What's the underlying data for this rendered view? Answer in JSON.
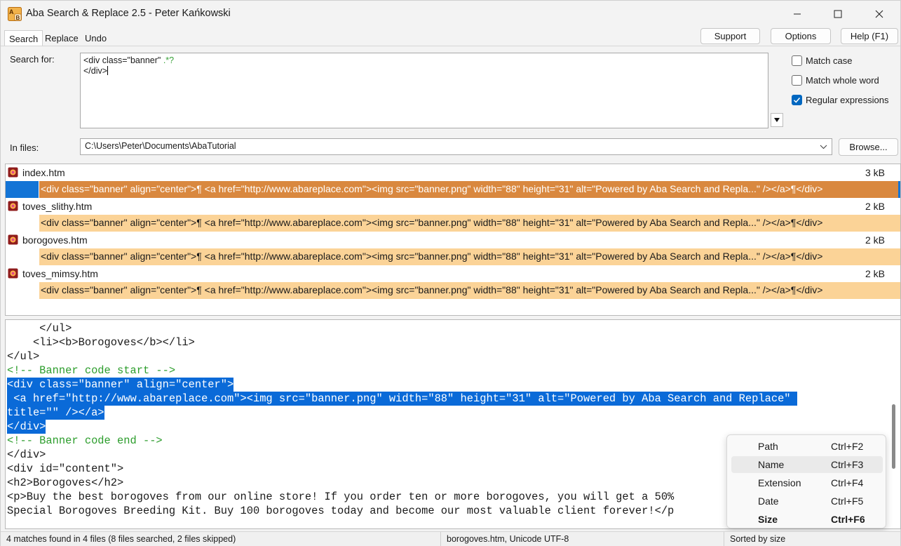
{
  "window": {
    "title": "Aba Search & Replace 2.5 - Peter Kańkowski",
    "app_icon": "aba-app-icon",
    "controls": [
      "minimize",
      "maximize",
      "close"
    ]
  },
  "tabs": [
    {
      "label": "Search",
      "active": true
    },
    {
      "label": "Replace",
      "active": false
    },
    {
      "label": "Undo",
      "active": false
    }
  ],
  "top_buttons": {
    "support": "Support",
    "options": "Options",
    "help": "Help (F1)"
  },
  "search": {
    "label": "Search for:",
    "line1_text": "<div class=\"banner\" ",
    "line1_regex": ".*?",
    "line2_text": "</div>"
  },
  "options": {
    "match_case": {
      "label": "Match case",
      "checked": false
    },
    "whole_word": {
      "label": "Match whole word",
      "checked": false
    },
    "regex": {
      "label": "Regular expressions",
      "checked": true
    }
  },
  "files": {
    "label": "In files:",
    "value": "C:\\Users\\Peter\\Documents\\AbaTutorial",
    "browse": "Browse..."
  },
  "results": [
    {
      "name": "index.htm",
      "size": "3 kB",
      "match": "<div class=\"banner\" align=\"center\">¶ <a href=\"http://www.abareplace.com\"><img src=\"banner.png\" width=\"88\" height=\"31\" alt=\"Powered by Aba Search and Repla...\" /></a>¶</div>",
      "selected": true
    },
    {
      "name": "toves_slithy.htm",
      "size": "2 kB",
      "match": "<div class=\"banner\" align=\"center\">¶ <a href=\"http://www.abareplace.com\"><img src=\"banner.png\" width=\"88\" height=\"31\" alt=\"Powered by Aba Search and Repla...\" /></a>¶</div>",
      "selected": false
    },
    {
      "name": "borogoves.htm",
      "size": "2 kB",
      "match": "<div class=\"banner\" align=\"center\">¶ <a href=\"http://www.abareplace.com\"><img src=\"banner.png\" width=\"88\" height=\"31\" alt=\"Powered by Aba Search and Repla...\" /></a>¶</div>",
      "selected": false
    },
    {
      "name": "toves_mimsy.htm",
      "size": "2 kB",
      "match": "<div class=\"banner\" align=\"center\">¶ <a href=\"http://www.abareplace.com\"><img src=\"banner.png\" width=\"88\" height=\"31\" alt=\"Powered by Aba Search and Repla...\" /></a>¶</div>",
      "selected": false
    }
  ],
  "viewer": {
    "lines": [
      {
        "text": "     </ul>",
        "kind": "code"
      },
      {
        "text": "    <li><b>Borogoves</b></li>",
        "kind": "code"
      },
      {
        "text": "</ul>",
        "kind": "code"
      },
      {
        "text": "<!-- Banner code start -->",
        "kind": "comment"
      },
      {
        "text": "<div class=\"banner\" align=\"center\">",
        "kind": "highlight"
      },
      {
        "text": " <a href=\"http://www.abareplace.com\"><img src=\"banner.png\" width=\"88\" height=\"31\" alt=\"Powered by Aba Search and Replace\" ",
        "kind": "highlight"
      },
      {
        "text": "title=\"\" /></a>",
        "kind": "highlight"
      },
      {
        "text": "</div>",
        "kind": "highlight"
      },
      {
        "text": "<!-- Banner code end -->",
        "kind": "comment"
      },
      {
        "text": "</div>",
        "kind": "code"
      },
      {
        "text": "<div id=\"content\">",
        "kind": "code"
      },
      {
        "text": "<h2>Borogoves</h2>",
        "kind": "code"
      },
      {
        "text": "<p>Buy the best borogoves from our online store! If you order ten or more borogoves, you will get a 50%",
        "kind": "code"
      },
      {
        "text": "Special Borogoves Breeding Kit. Buy 100 borogoves today and become our most valuable client forever!</p",
        "kind": "code"
      }
    ]
  },
  "context_menu": [
    {
      "label": "Path",
      "shortcut": "Ctrl+F2",
      "hover": false,
      "bold": false
    },
    {
      "label": "Name",
      "shortcut": "Ctrl+F3",
      "hover": true,
      "bold": false
    },
    {
      "label": "Extension",
      "shortcut": "Ctrl+F4",
      "hover": false,
      "bold": false
    },
    {
      "label": "Date",
      "shortcut": "Ctrl+F5",
      "hover": false,
      "bold": false
    },
    {
      "label": "Size",
      "shortcut": "Ctrl+F6",
      "hover": false,
      "bold": true
    }
  ],
  "status": {
    "matches": "4 matches found in 4 files (8 files searched, 2 files skipped)",
    "file_info": "borogoves.htm, Unicode UTF-8",
    "sort": "Sorted by size"
  },
  "colors": {
    "accent": "#0067c0",
    "match_bg": "#fbd397",
    "match_selected_bg": "#d9883f",
    "code_selection": "#0a6ad8",
    "comment": "#2c9d2c"
  }
}
